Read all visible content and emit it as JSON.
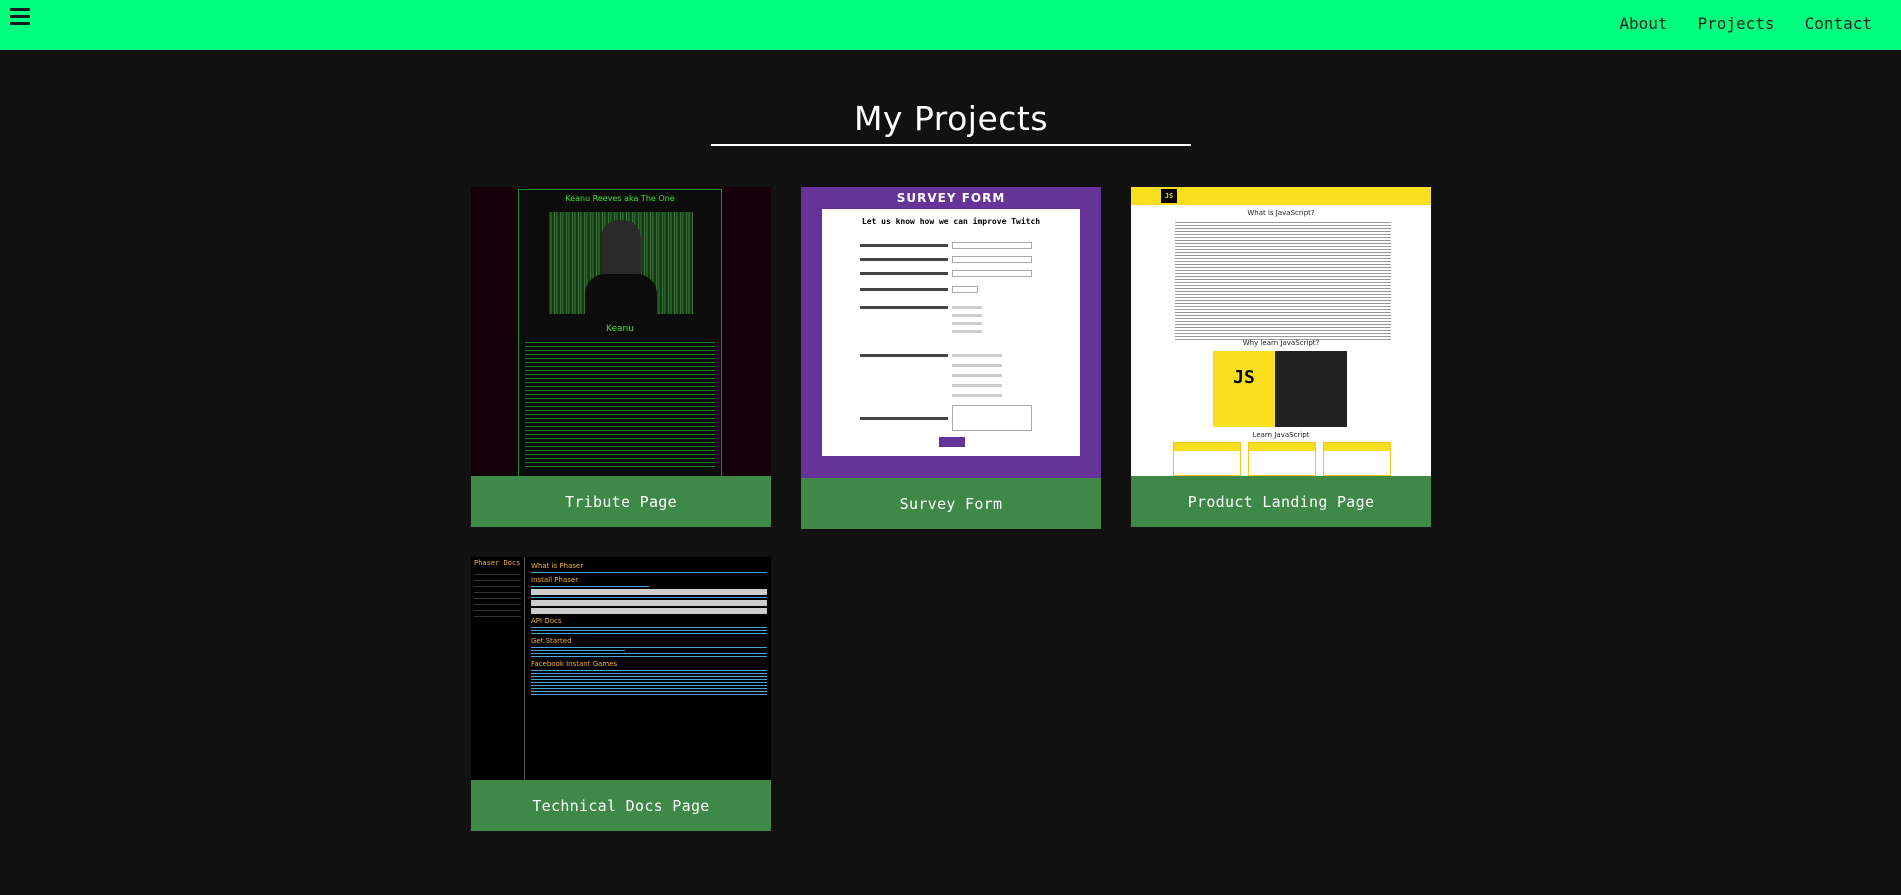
{
  "nav": {
    "menu_icon": "hamburger-menu-icon",
    "links": [
      "About",
      "Projects",
      "Contact"
    ]
  },
  "page": {
    "title": "My Projects"
  },
  "projects": [
    {
      "caption": "Tribute Page",
      "thumb": {
        "title": "Keanu Reeves aka The One",
        "subtitle": "Keanu"
      }
    },
    {
      "caption": "Survey Form",
      "thumb": {
        "title": "SURVEY FORM",
        "subtitle": "Let us know how we can improve Twitch"
      }
    },
    {
      "caption": "Product Landing Page",
      "thumb": {
        "logo": "JS",
        "heading1": "What is JavaScript?",
        "heading2": "Why learn JavaScript?",
        "heading3": "Learn JavaScript",
        "video_text": "JS"
      }
    },
    {
      "caption": "Technical Docs Page",
      "thumb": {
        "logo": "Phaser Docs",
        "sections": [
          "What is Phaser",
          "Install Phaser",
          "API Docs",
          "Get Started",
          "Facebook Instant Games"
        ]
      }
    }
  ],
  "colors": {
    "nav_bg": "#00ff7f",
    "page_bg": "#111111",
    "caption_bg": "#3e8948"
  }
}
